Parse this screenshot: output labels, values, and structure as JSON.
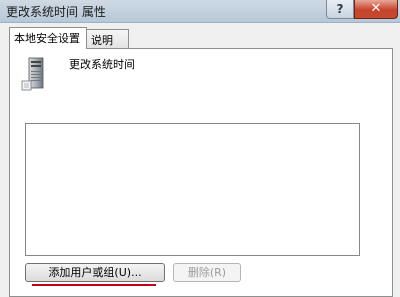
{
  "window": {
    "title": "更改系统时间 属性",
    "help_glyph": "?",
    "close_glyph": "✕"
  },
  "tabs": [
    {
      "label": "本地安全设置",
      "active": true
    },
    {
      "label": "说明",
      "active": false
    }
  ],
  "policy": {
    "name": "更改系统时间",
    "icon": "computer-tower-icon"
  },
  "buttons": {
    "add_label": "添加用户或组(U)...",
    "remove_label": "删除(R)"
  },
  "colors": {
    "accent_underline": "#c0001a",
    "close_button": "#c7432c"
  }
}
